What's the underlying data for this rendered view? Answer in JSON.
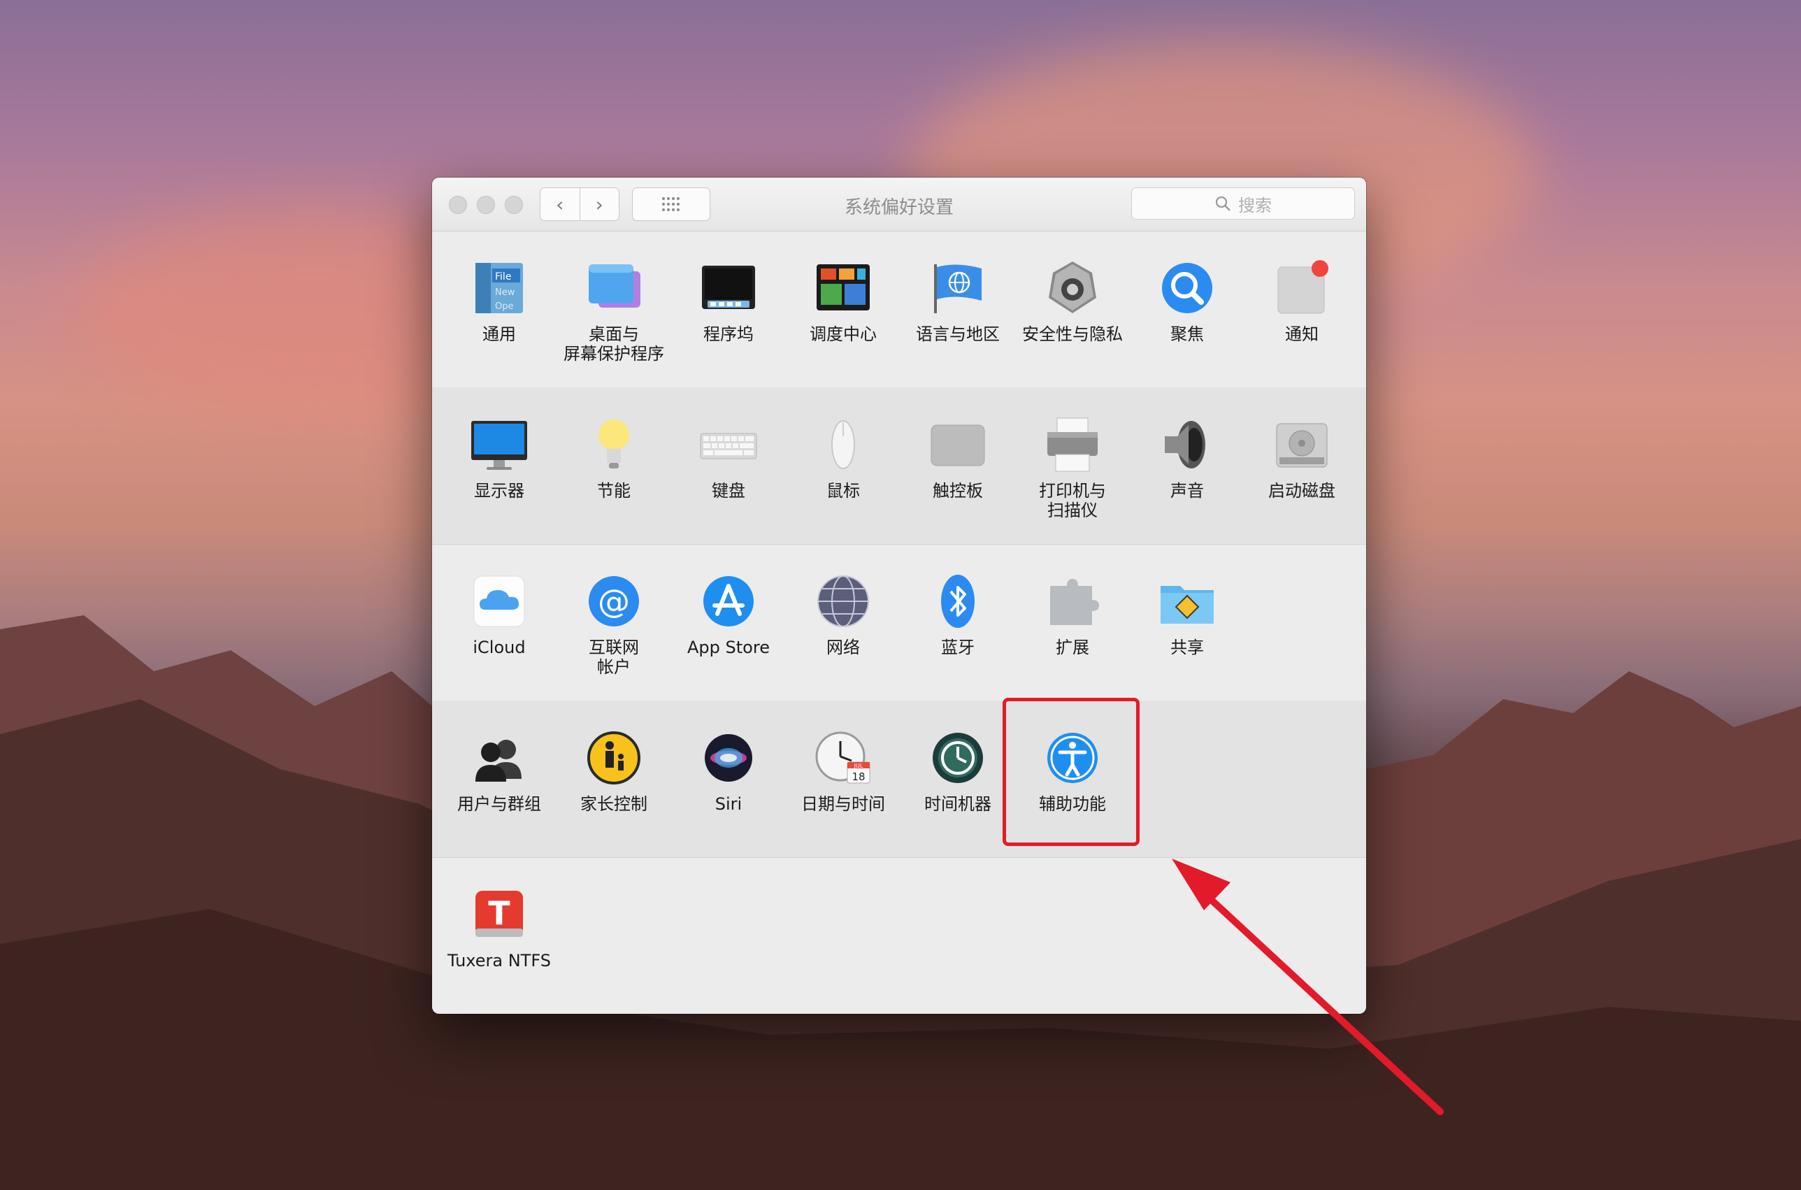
{
  "window": {
    "title": "系统偏好设置",
    "search_placeholder": "搜索"
  },
  "rows": [
    [
      {
        "label": "通用",
        "icon": "general-icon"
      },
      {
        "label": "桌面与\n屏幕保护程序",
        "icon": "desktop-screensaver-icon"
      },
      {
        "label": "程序坞",
        "icon": "dock-icon"
      },
      {
        "label": "调度中心",
        "icon": "mission-control-icon"
      },
      {
        "label": "语言与地区",
        "icon": "language-region-icon"
      },
      {
        "label": "安全性与隐私",
        "icon": "security-privacy-icon"
      },
      {
        "label": "聚焦",
        "icon": "spotlight-icon"
      },
      {
        "label": "通知",
        "icon": "notifications-icon"
      }
    ],
    [
      {
        "label": "显示器",
        "icon": "displays-icon"
      },
      {
        "label": "节能",
        "icon": "energy-saver-icon"
      },
      {
        "label": "键盘",
        "icon": "keyboard-icon"
      },
      {
        "label": "鼠标",
        "icon": "mouse-icon"
      },
      {
        "label": "触控板",
        "icon": "trackpad-icon"
      },
      {
        "label": "打印机与\n扫描仪",
        "icon": "printers-scanners-icon"
      },
      {
        "label": "声音",
        "icon": "sound-icon"
      },
      {
        "label": "启动磁盘",
        "icon": "startup-disk-icon"
      }
    ],
    [
      {
        "label": "iCloud",
        "icon": "icloud-icon"
      },
      {
        "label": "互联网\n帐户",
        "icon": "internet-accounts-icon"
      },
      {
        "label": "App Store",
        "icon": "app-store-icon"
      },
      {
        "label": "网络",
        "icon": "network-icon"
      },
      {
        "label": "蓝牙",
        "icon": "bluetooth-icon"
      },
      {
        "label": "扩展",
        "icon": "extensions-icon"
      },
      {
        "label": "共享",
        "icon": "sharing-icon"
      }
    ],
    [
      {
        "label": "用户与群组",
        "icon": "users-groups-icon"
      },
      {
        "label": "家长控制",
        "icon": "parental-controls-icon"
      },
      {
        "label": "Siri",
        "icon": "siri-icon"
      },
      {
        "label": "日期与时间",
        "icon": "date-time-icon"
      },
      {
        "label": "时间机器",
        "icon": "time-machine-icon"
      },
      {
        "label": "辅助功能",
        "icon": "accessibility-icon"
      }
    ],
    [
      {
        "label": "Tuxera NTFS",
        "icon": "tuxera-ntfs-icon"
      }
    ]
  ],
  "calendar_icon": {
    "month": "JUL",
    "day": "18"
  },
  "annotation": {
    "highlight_color": "#e31a2a",
    "highlighted_item": "辅助功能"
  }
}
